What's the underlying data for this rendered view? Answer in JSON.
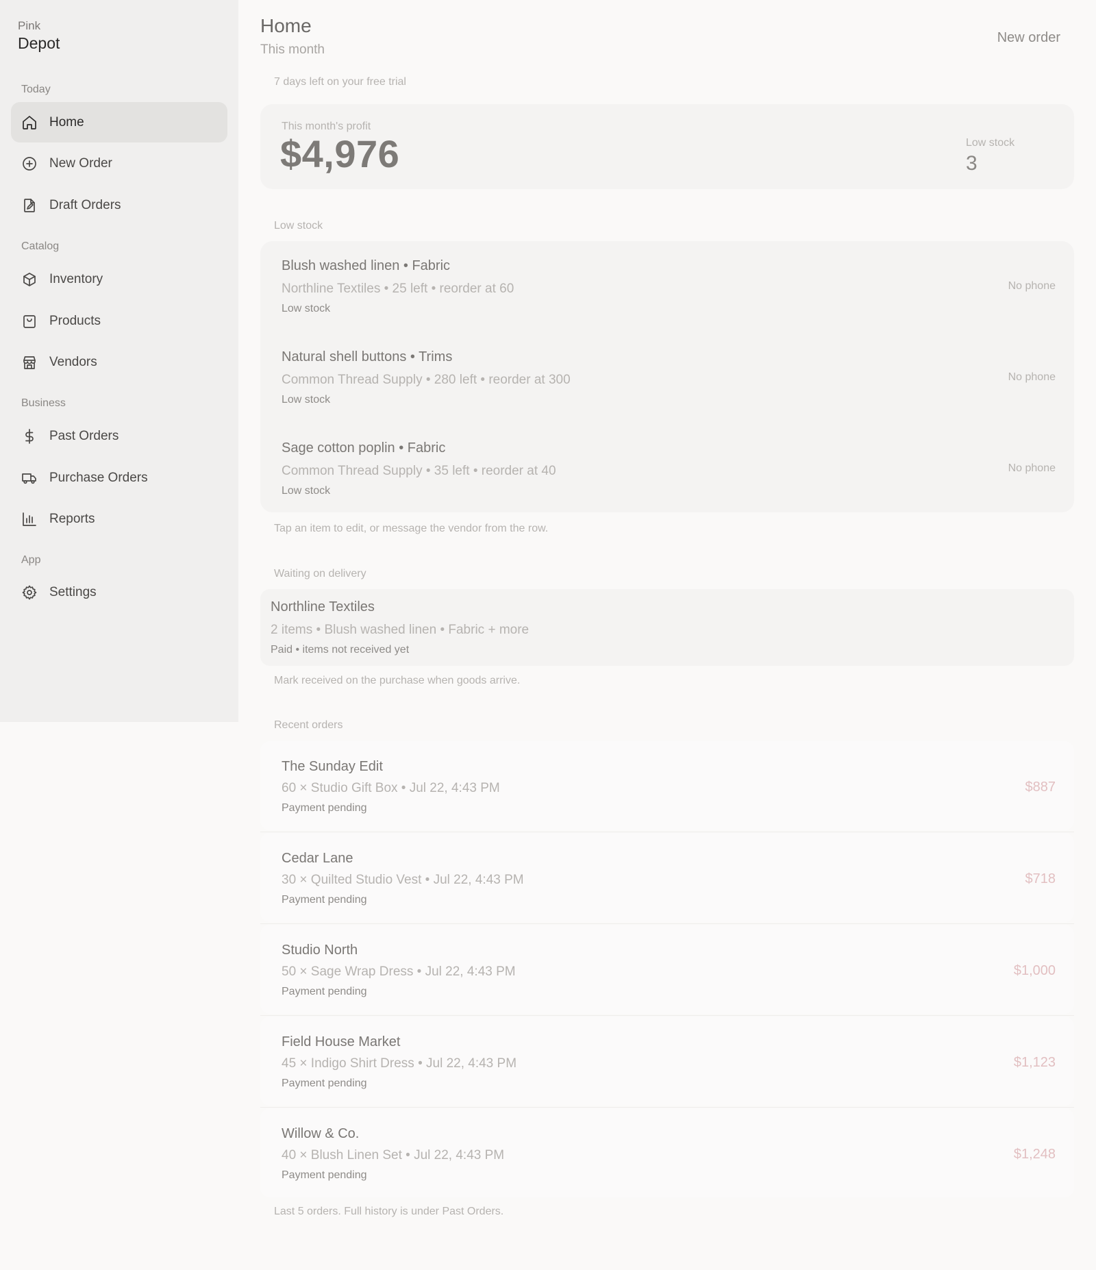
{
  "brand": {
    "top": "Pink",
    "main": "Depot"
  },
  "sidebar": {
    "sections": [
      {
        "label": "Today"
      },
      {
        "label": "Catalog"
      },
      {
        "label": "Business"
      },
      {
        "label": "App"
      }
    ],
    "items": [
      {
        "label": "Home",
        "icon": "home-icon"
      },
      {
        "label": "New Order",
        "icon": "plus-circle-icon"
      },
      {
        "label": "Draft Orders",
        "icon": "draft-document-icon"
      },
      {
        "label": "Inventory",
        "icon": "box-icon"
      },
      {
        "label": "Products",
        "icon": "shopping-bag-icon"
      },
      {
        "label": "Vendors",
        "icon": "store-icon"
      },
      {
        "label": "Past Orders",
        "icon": "dollar-icon"
      },
      {
        "label": "Purchase Orders",
        "icon": "truck-icon"
      },
      {
        "label": "Reports",
        "icon": "bar-chart-icon"
      },
      {
        "label": "Settings",
        "icon": "gear-icon"
      }
    ]
  },
  "header": {
    "title": "Home",
    "subtitle": "This month",
    "new_order_label": "New order"
  },
  "trial_note": "7 days left on your free trial",
  "summary": {
    "profit_label": "This month's profit",
    "profit_value": "$4,976",
    "low_stock_label": "Low stock",
    "low_stock_value": "3"
  },
  "low_stock": {
    "heading": "Low stock",
    "items": [
      {
        "title": "Blush washed linen • Fabric",
        "detail": "Northline Textiles • 25 left • reorder at 60",
        "status": "Low stock",
        "contact": "No phone"
      },
      {
        "title": "Natural shell buttons • Trims",
        "detail": "Common Thread Supply • 280 left • reorder at 300",
        "status": "Low stock",
        "contact": "No phone"
      },
      {
        "title": "Sage cotton poplin • Fabric",
        "detail": "Common Thread Supply • 35 left • reorder at 40",
        "status": "Low stock",
        "contact": "No phone"
      }
    ],
    "footnote": "Tap an item to edit, or message the vendor from the row."
  },
  "waiting": {
    "heading": "Waiting on delivery",
    "item": {
      "title": "Northline Textiles",
      "detail": "2 items • Blush washed linen • Fabric + more",
      "status": "Paid • items not received yet"
    },
    "footnote": "Mark received on the purchase when goods arrive."
  },
  "recent_orders": {
    "heading": "Recent orders",
    "items": [
      {
        "customer": "The Sunday Edit",
        "detail": "60 × Studio Gift Box • Jul 22, 4:43 PM",
        "status": "Payment pending",
        "amount": "$887"
      },
      {
        "customer": "Cedar Lane",
        "detail": "30 × Quilted Studio Vest • Jul 22, 4:43 PM",
        "status": "Payment pending",
        "amount": "$718"
      },
      {
        "customer": "Studio North",
        "detail": "50 × Sage Wrap Dress • Jul 22, 4:43 PM",
        "status": "Payment pending",
        "amount": "$1,000"
      },
      {
        "customer": "Field House Market",
        "detail": "45 × Indigo Shirt Dress • Jul 22, 4:43 PM",
        "status": "Payment pending",
        "amount": "$1,123"
      },
      {
        "customer": "Willow & Co.",
        "detail": "40 × Blush Linen Set • Jul 22, 4:43 PM",
        "status": "Payment pending",
        "amount": "$1,248"
      }
    ],
    "footnote": "Last 5 orders. Full history is under Past Orders."
  },
  "colors": {
    "sidebar_bg": "#f0efee",
    "active_bg": "#e3e2e0",
    "page_bg": "#faf9f8",
    "amount": "#e2bfc1"
  }
}
